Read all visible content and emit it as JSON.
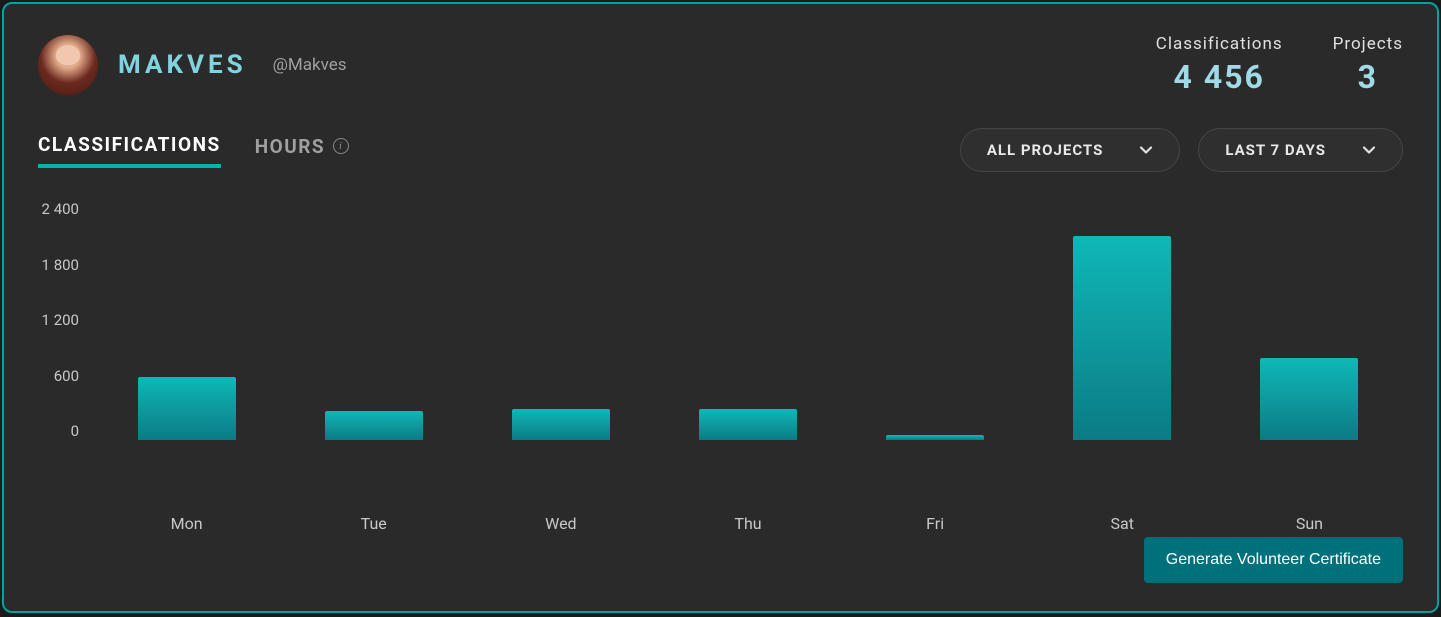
{
  "profile": {
    "display_name": "MAKVES",
    "handle": "@Makves"
  },
  "stats": {
    "classifications_label": "Classifications",
    "classifications_value": "4 456",
    "projects_label": "Projects",
    "projects_value": "3"
  },
  "tabs": {
    "classifications": "CLASSIFICATIONS",
    "hours": "HOURS"
  },
  "filters": {
    "projects": "ALL PROJECTS",
    "range": "LAST 7 DAYS"
  },
  "buttons": {
    "generate_certificate": "Generate Volunteer Certificate"
  },
  "chart_data": {
    "type": "bar",
    "categories": [
      "Mon",
      "Tue",
      "Wed",
      "Thu",
      "Fri",
      "Sat",
      "Sun"
    ],
    "values": [
      630,
      290,
      310,
      310,
      50,
      2040,
      820
    ],
    "title": "",
    "xlabel": "",
    "ylabel": "",
    "ylim": [
      0,
      2400
    ],
    "y_ticks": [
      "2 400",
      "1 800",
      "1 200",
      "600",
      "0"
    ]
  }
}
